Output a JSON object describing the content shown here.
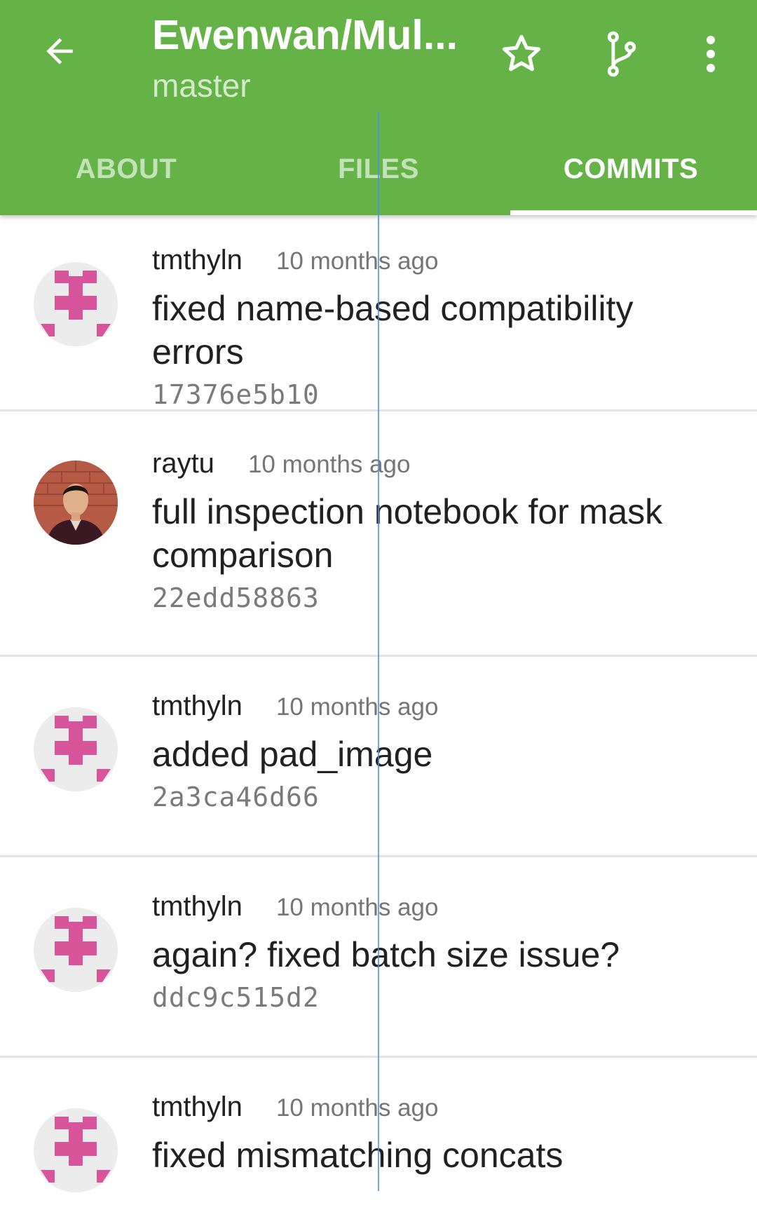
{
  "header": {
    "back_icon": "arrow-left-icon",
    "title": "Ewenwan/Mul...",
    "subtitle": "master",
    "actions": {
      "star_icon": "star-outline-icon",
      "branch_icon": "git-branch-icon",
      "menu_icon": "more-vertical-icon"
    },
    "accent_color": "#65b346"
  },
  "tabs": [
    {
      "label": "ABOUT",
      "active": false
    },
    {
      "label": "FILES",
      "active": false
    },
    {
      "label": "COMMITS",
      "active": true
    }
  ],
  "commits": [
    {
      "author": "tmthyln",
      "time": "10 months ago",
      "message": "fixed name-based compatibility errors",
      "sha": "17376e5b10",
      "avatar": "identicon-pink"
    },
    {
      "author": "raytu",
      "time": "10 months ago",
      "message": "full inspection notebook for mask comparison",
      "sha": "22edd58863",
      "avatar": "photo-portrait"
    },
    {
      "author": "tmthyln",
      "time": "10 months ago",
      "message": "added pad_image",
      "sha": "2a3ca46d66",
      "avatar": "identicon-pink"
    },
    {
      "author": "tmthyln",
      "time": "10 months ago",
      "message": "again? fixed batch size issue?",
      "sha": "ddc9c515d2",
      "avatar": "identicon-pink"
    },
    {
      "author": "tmthyln",
      "time": "10 months ago",
      "message": "fixed mismatching concats",
      "sha": "",
      "avatar": "identicon-pink"
    }
  ],
  "identicon_color": "#d9559b"
}
